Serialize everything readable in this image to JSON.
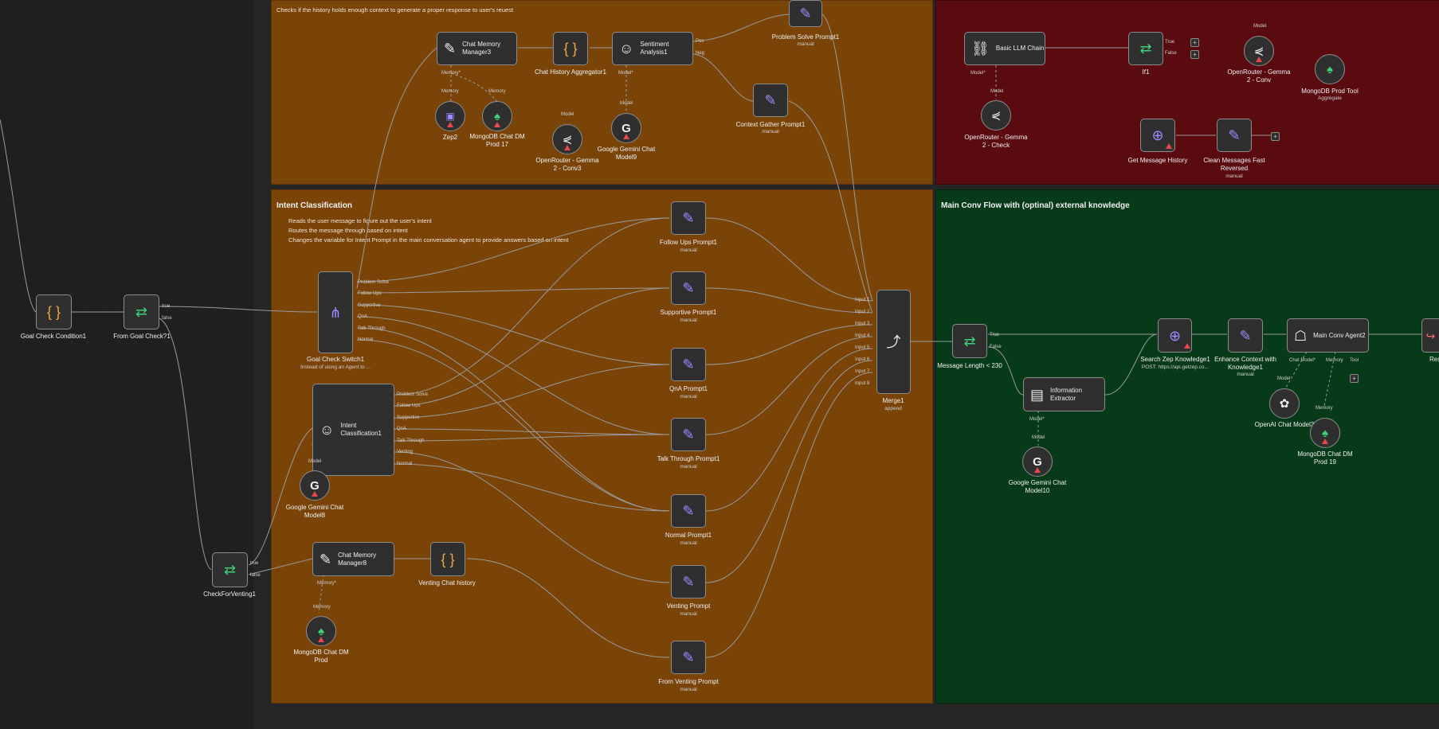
{
  "groups": {
    "context_note": "Checks if the history holds enough context to generate a proper response to user's reuest",
    "intent_title": "Intent Classification",
    "intent_notes": [
      "Reads the user message to figure out the user's intent",
      "Routes the message through based on intent",
      "Changes the variable for Intent Prompt in the main conversation agent to provide answers based on intent"
    ],
    "green_title": "Main Conv Flow with (optinal) external knowledge"
  },
  "nodes": {
    "goal_check_condition": "Goal Check Condition1",
    "from_goal_check": "From Goal Check?1",
    "check_for_venting": "CheckForVenting1",
    "chat_memory_manager3": "Chat Memory Manager3",
    "chat_history_aggregator": "Chat History Aggregator1",
    "sentiment_analysis": "Sentiment Analysis1",
    "problem_solve_prompt": "Problem Solve Prompt1",
    "problem_solve_sub": "manual",
    "context_gather_prompt": "Context Gather Prompt1",
    "context_gather_sub": "manual",
    "zep2": "Zep2",
    "mongodb_17": "MongoDB Chat DM Prod 17",
    "openrouter_conv3": "OpenRouter - Gemma 2 - Conv3",
    "gemini_model9": "Google Gemini Chat Model9",
    "goal_check_switch": "Goal Check Switch1",
    "goal_check_switch_sub": "Instead of using an Agent to ...",
    "intent_classification": "Intent Classification1",
    "gemini_model8": "Google Gemini Chat Model8",
    "chat_memory_manager8": "Chat Memory Manager8",
    "venting_chat_history": "Venting Chat history",
    "mongodb_prod": "MongoDB Chat DM Prod",
    "follow_ups_prompt": "Follow Ups Prompt1",
    "supportive_prompt": "Supportive Prompt1",
    "qna_prompt": "QnA Prompt1",
    "talk_through_prompt": "Talk Through Prompt1",
    "normal_prompt": "Normal Prompt1",
    "venting_prompt": "Venting Prompt",
    "from_venting_prompt": "From Venting Prompt",
    "manual": "manual",
    "merge": "Merge1",
    "merge_sub": "append",
    "basic_llm_chain": "Basic LLM Chain",
    "if1": "If1",
    "openrouter_conv": "OpenRouter - Gemma 2 - Conv",
    "mongodb_prod_tool": "MongoDB Prod Tool",
    "mongodb_prod_tool_sub": "Aggregate",
    "openrouter_check": "OpenRouter - Gemma 2 - Check",
    "get_message_history": "Get Message History",
    "clean_messages": "Clean Messages Fast Reversed",
    "clean_messages_sub": "manual",
    "message_length": "Message Length < 230",
    "information_extractor": "Information Extractor",
    "gemini_model10": "Google Gemini Chat Model10",
    "search_zep": "Search Zep Knowledge1",
    "search_zep_sub": "POST: https://api.getzep.co...",
    "enhance_context": "Enhance Context with Knowledge1",
    "enhance_context_sub": "manual",
    "main_conv_agent": "Main Conv Agent2",
    "openai_model": "OpenAI Chat Model3",
    "mongodb_19": "MongoDB Chat DM Prod 19",
    "respond_to": "Respond to"
  },
  "ports": {
    "true": "true",
    "false": "false",
    "true_short": "True",
    "false_short": "False",
    "memory": "Memory",
    "memory_req": "Memory*",
    "model": "Model",
    "model_req": "Model*",
    "chat_model_req": "Chat Model*",
    "tool": "Tool",
    "switch_outputs": [
      "Problem Solve",
      "Follow Ups",
      "Supportive",
      "QnA",
      "Talk Through",
      "Normal"
    ],
    "intent_outputs": [
      "Problem Solve",
      "Follow Ups",
      "Supportive",
      "QnA",
      "Talk Through",
      "Venting",
      "Normal"
    ],
    "merge_inputs": [
      "Input 1",
      "Input 2",
      "Input 3",
      "Input 4",
      "Input 5",
      "Input 6",
      "Input 7",
      "Input 8"
    ],
    "sentiment_outputs": [
      "Pos",
      "Neg"
    ]
  },
  "colors": {
    "orange_group": "#7a4409",
    "red_group": "#5a0b10",
    "green_group": "#073a18",
    "node_bg": "#2f2f2f",
    "wire": "#9a9a9a",
    "warn": "#e5484d",
    "icon_purple": "#9b8cff",
    "icon_green": "#3fd07a",
    "icon_orange": "#f5a742"
  }
}
